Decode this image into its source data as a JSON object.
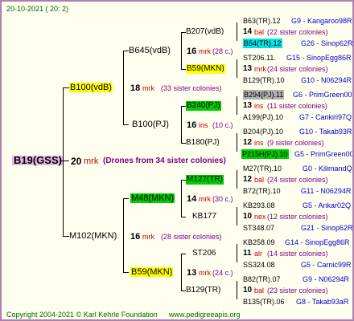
{
  "header": {
    "date": "20-10-2021 ( 20: 2)"
  },
  "footer": {
    "copyright": "Copyright 2004-2021 © Karl Kehrle Foundation",
    "site": "www.pedigreeapis.org"
  },
  "root": {
    "name": "B19(GSS)",
    "number": "20",
    "mark": "mrk",
    "note": "(Drones from 34 sister colonies)"
  },
  "parents": [
    {
      "name": "B100(vdB)",
      "number": "18",
      "mark": "mrk",
      "note": "(33 sister colonies)"
    },
    {
      "name": "M102(MKN)",
      "number": "16",
      "mark": "mrk",
      "note": "(28 sister colonies)"
    }
  ],
  "grand": [
    {
      "name": "B645(vdB)",
      "number": "16",
      "mark": "mrk",
      "note": "(28 c.)"
    },
    {
      "name": "B100(PJ)",
      "number": "16",
      "mark": "ins",
      "note": "(10 c.)"
    },
    {
      "name": "M48(MKN)",
      "number": "14",
      "mark": "mrk",
      "note": "(30 c.)"
    },
    {
      "name": "B59(MKN)",
      "number": "13",
      "mark": "mrk",
      "note": "(24 c.)"
    }
  ],
  "ggp": [
    {
      "name": "B207(vdB)"
    },
    {
      "name": "B59(MKN)"
    },
    {
      "name": "B240(PJ)"
    },
    {
      "name": "B180(PJ)"
    },
    {
      "name": "M127(TR)"
    },
    {
      "name": "KB177"
    },
    {
      "name": "ST206"
    },
    {
      "name": "B129(TR)"
    }
  ],
  "ggp_info": [
    {
      "number": "14",
      "mark": "bal",
      "note": "(22 sister colonies)"
    },
    {
      "number": "13",
      "mark": "mrk",
      "note": "(24 sister colonies)"
    },
    {
      "number": "13",
      "mark": "ins",
      "note": "(11 sister colonies)"
    },
    {
      "number": "12",
      "mark": "ins",
      "note": "(9 sister colonies)"
    },
    {
      "number": "12",
      "mark": "bal",
      "note": "(24 sister colonies)"
    },
    {
      "number": "10",
      "mark": "nex",
      "note": "(12 sister colonies)"
    },
    {
      "number": "11",
      "mark": "alr",
      "note": "(14 sister colonies)"
    },
    {
      "number": "10",
      "mark": "bal",
      "note": "(23 sister colonies)"
    }
  ],
  "leaves": [
    {
      "name": "B63(TR).12",
      "gen": "G9 - Kangaroo98R"
    },
    {
      "name": "B54(TR).12",
      "gen": "G26 - Sinop62R"
    },
    {
      "name": "ST206.11.",
      "gen": "G15 - SinopEgg86R"
    },
    {
      "name": "B129(TR).10",
      "gen": "G10 - N06294R"
    },
    {
      "name": "B294(PJ).11",
      "gen": "G6 - PrimGreen00"
    },
    {
      "name": "A199(PJ).10",
      "gen": "G7 - Cankiri97Q"
    },
    {
      "name": "B204(PJ).10",
      "gen": "G10 - Takab93R"
    },
    {
      "name": "P215H(PJ).10",
      "gen": "G5 - PrimGreen00"
    },
    {
      "name": "M27(TR).10",
      "gen": "G0 - KilimandQ"
    },
    {
      "name": "B72(TR).10",
      "gen": "G11 - N06294R"
    },
    {
      "name": "KB293.08",
      "gen": "G5 - Ankar02Q"
    },
    {
      "name": "ST348.07",
      "gen": "G21 - Sinop62R"
    },
    {
      "name": "KB258.09",
      "gen": "G14 - SinopEgg86R"
    },
    {
      "name": "SS324.08",
      "gen": "G5 - Carnic99R"
    },
    {
      "name": "B82(TR).07",
      "gen": "G9 - N06294R"
    },
    {
      "name": "B135(TR).06",
      "gen": "G8 - Takab93aR"
    }
  ]
}
